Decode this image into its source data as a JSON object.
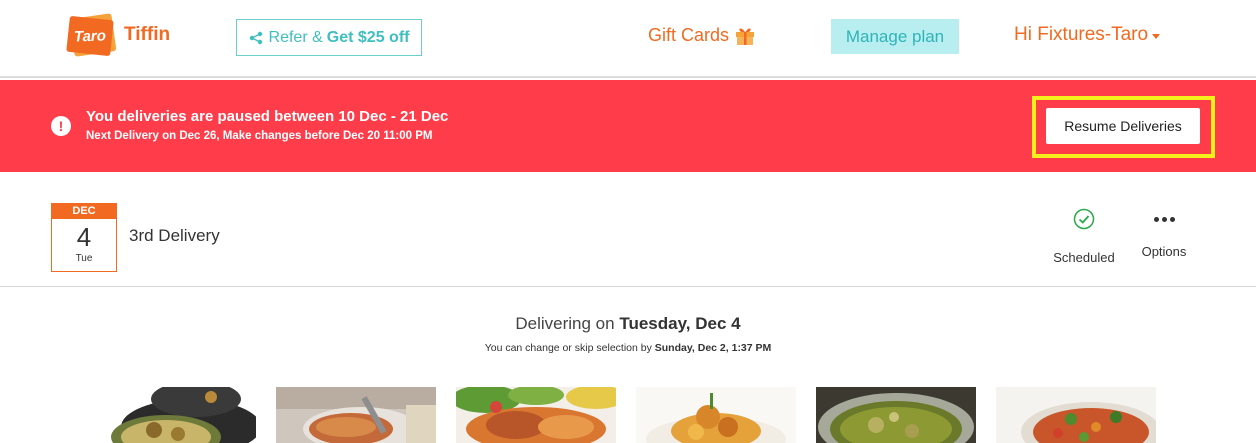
{
  "header": {
    "logo_text": "Taro",
    "brand": "Tiffin",
    "refer": {
      "prefix": "Refer &",
      "highlight": "Get $25 off"
    },
    "gift_cards": "Gift Cards",
    "manage_plan": "Manage plan",
    "greeting": "Hi Fixtures-Taro"
  },
  "banner": {
    "title": "You deliveries are paused between 10 Dec - 21 Dec",
    "subtitle": "Next Delivery on Dec 26, Make changes before Dec 20 11:00 PM",
    "resume_label": "Resume Deliveries",
    "color": "#ff3d4a",
    "highlight_color": "#f4f01c"
  },
  "delivery": {
    "month": "DEC",
    "day": "4",
    "weekday": "Tue",
    "title": "3rd Delivery",
    "status": "Scheduled",
    "options": "Options"
  },
  "schedule": {
    "prefix": "Delivering on",
    "date": "Tuesday, Dec 4",
    "sub_prefix": "You can change or skip selection by",
    "deadline": "Sunday, Dec 2, 1:37 PM"
  },
  "foods": [
    {
      "icon": "food-thumbnail-1"
    },
    {
      "icon": "food-thumbnail-2"
    },
    {
      "icon": "food-thumbnail-3"
    },
    {
      "icon": "food-thumbnail-4"
    },
    {
      "icon": "food-thumbnail-5"
    },
    {
      "icon": "food-thumbnail-6"
    }
  ],
  "colors": {
    "accent": "#f26a21",
    "teal": "#3fbfbf",
    "success": "#2aa84a"
  }
}
